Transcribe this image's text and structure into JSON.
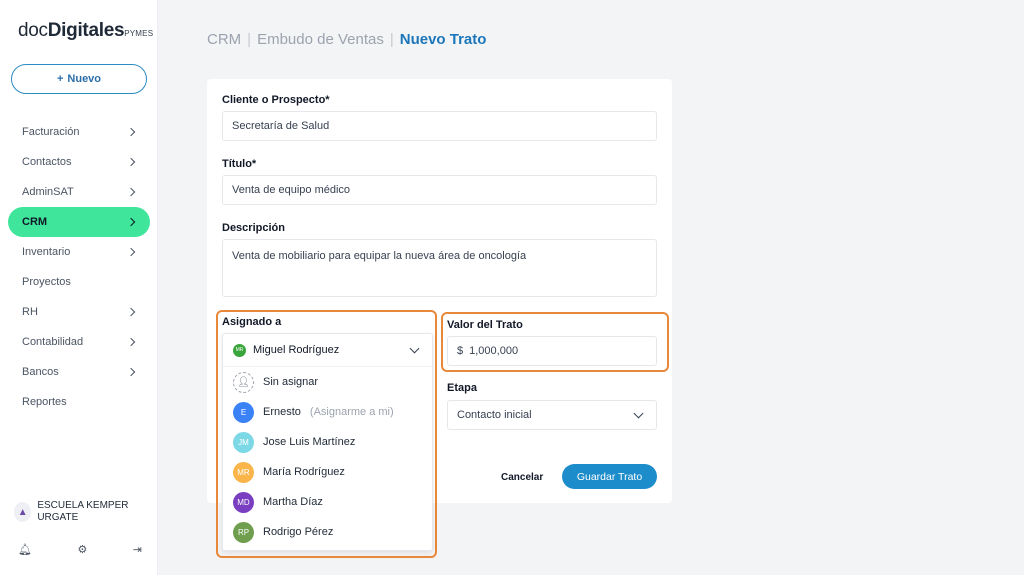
{
  "brand": {
    "part1": "doc",
    "part2": "Digitales",
    "suffix": "PYMES"
  },
  "new_button": {
    "icon": "+",
    "label": "Nuevo"
  },
  "nav": [
    {
      "label": "Facturación",
      "chevron": true,
      "active": false
    },
    {
      "label": "Contactos",
      "chevron": true,
      "active": false
    },
    {
      "label": "AdminSAT",
      "chevron": true,
      "active": false
    },
    {
      "label": "CRM",
      "chevron": true,
      "active": true
    },
    {
      "label": "Inventario",
      "chevron": true,
      "active": false
    },
    {
      "label": "Proyectos",
      "chevron": false,
      "active": false
    },
    {
      "label": "RH",
      "chevron": true,
      "active": false
    },
    {
      "label": "Contabilidad",
      "chevron": true,
      "active": false
    },
    {
      "label": "Bancos",
      "chevron": true,
      "active": false
    },
    {
      "label": "Reportes",
      "chevron": false,
      "active": false
    }
  ],
  "organization": {
    "name": "ESCUELA KEMPER URGATE"
  },
  "footer_icons": [
    "bell-icon",
    "gear-icon",
    "logout-icon"
  ],
  "breadcrumb": {
    "items": [
      "CRM",
      "Embudo de Ventas"
    ],
    "current": "Nuevo Trato"
  },
  "form": {
    "client": {
      "label": "Cliente o Prospecto*",
      "value": "Secretaría de Salud"
    },
    "title": {
      "label": "Título*",
      "value": "Venta de equipo médico"
    },
    "description": {
      "label": "Descripción",
      "value": "Venta de mobiliario para equipar la nueva área de oncología"
    },
    "assigned": {
      "label": "Asignado a",
      "selected": {
        "initials": "MR",
        "name": "Miguel Rodríguez",
        "color": "#3aa53a"
      },
      "options": [
        {
          "initials": "",
          "name": "Sin asignar",
          "hint": "",
          "color": "#ffffff"
        },
        {
          "initials": "E",
          "name": "Ernesto",
          "hint": "(Asignarme a mi)",
          "color": "#3b82f6"
        },
        {
          "initials": "JM",
          "name": "Jose Luis Martínez",
          "hint": "",
          "color": "#7dd8e6"
        },
        {
          "initials": "MR",
          "name": "María Rodríguez",
          "hint": "",
          "color": "#f9b54a"
        },
        {
          "initials": "MD",
          "name": "Martha Díaz",
          "hint": "",
          "color": "#7a3fc1"
        },
        {
          "initials": "RP",
          "name": "Rodrigo Pérez",
          "hint": "",
          "color": "#6f9e4e"
        }
      ]
    },
    "deal_value": {
      "label": "Valor del Trato",
      "currency": "$",
      "value": "1,000,000"
    },
    "stage": {
      "label": "Etapa",
      "value": "Contacto inicial"
    },
    "cancel_label": "Cancelar",
    "save_label": "Guardar Trato"
  },
  "colors": {
    "accent": "#1d8ccb",
    "active_nav": "#3ee59a",
    "highlight": "#e8883a"
  }
}
